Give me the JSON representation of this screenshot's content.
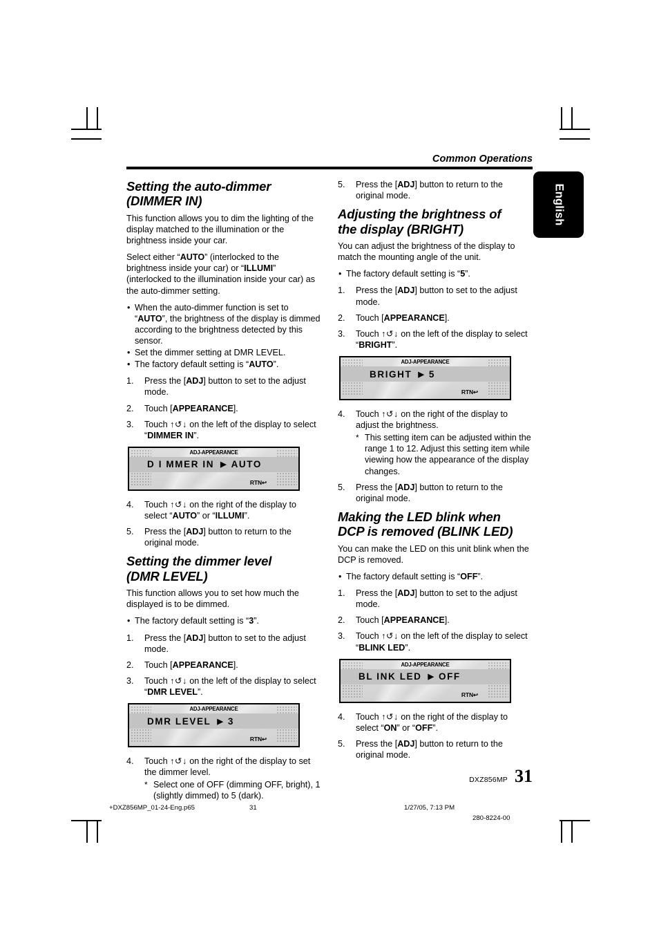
{
  "running_head": "Common Operations",
  "language_tab": "English",
  "left_column": {
    "section1": {
      "heading_line1": "Setting the auto-dimmer",
      "heading_line2": "(DIMMER IN)",
      "intro": "This function allows you to dim the lighting of the display matched to the illumination or the brightness inside your car.",
      "para2_a": "Select either “",
      "para2_b": "AUTO",
      "para2_c": "” (interlocked to the brightness inside your car) or “",
      "para2_d": "ILLUMI",
      "para2_e": "” (interlocked to the illumination inside your car) as the auto-dimmer setting.",
      "bullet1_a": "When the auto-dimmer function is set to “",
      "bullet1_b": "AUTO",
      "bullet1_c": "”, the brightness of the display is dimmed according to the brightness detected by this sensor.",
      "bullet2": "Set the dimmer setting at DMR LEVEL.",
      "bullet3_a": "The factory default setting is “",
      "bullet3_b": "AUTO",
      "bullet3_c": "”.",
      "step1_num": "1.",
      "step1_a": "Press the [",
      "step1_b": "ADJ",
      "step1_c": "] button to set to the adjust mode.",
      "step2_num": "2.",
      "step2_a": "Touch [",
      "step2_b": "APPEARANCE",
      "step2_c": "].",
      "step3_num": "3.",
      "step3_a": "Touch ",
      "step3_b": " on the left of the display to select “",
      "step3_c": "DIMMER IN",
      "step3_d": "”.",
      "lcd": {
        "title": "ADJ-APPEARANCE",
        "label": "D I MMER   IN",
        "arrow": "▶",
        "value": "AUTO",
        "rtn": "RTN"
      },
      "step4_num": "4.",
      "step4_a": "Touch ",
      "step4_b": " on the right of the display to select “",
      "step4_c": "AUTO",
      "step4_d": "” or “",
      "step4_e": "ILLUMI",
      "step4_f": "”.",
      "step5_num": "5.",
      "step5_a": "Press the [",
      "step5_b": "ADJ",
      "step5_c": "] button to return to the original mode."
    },
    "section2": {
      "heading_line1": "Setting the dimmer level",
      "heading_line2": "(DMR LEVEL)",
      "intro": "This function allows you to set how much the displayed is to be dimmed.",
      "bullet1_a": "The factory default setting is “",
      "bullet1_b": "3",
      "bullet1_c": "”.",
      "step1_num": "1.",
      "step1_a": "Press the [",
      "step1_b": "ADJ",
      "step1_c": "] button to set to the adjust mode.",
      "step2_num": "2.",
      "step2_a": "Touch [",
      "step2_b": "APPEARANCE",
      "step2_c": "].",
      "step3_num": "3.",
      "step3_a": "Touch ",
      "step3_b": " on the left of the display to select “",
      "step3_c": "DMR LEVEL",
      "step3_d": "”.",
      "lcd": {
        "title": "ADJ-APPEARANCE",
        "label": "DMR  LEVEL",
        "arrow": "▶",
        "value": "3",
        "rtn": "RTN"
      },
      "step4_num": "4.",
      "step4_a": "Touch ",
      "step4_b": " on the right of the display to set the dimmer level.",
      "step4_note": "Select one of OFF (dimming OFF, bright), 1 (slightly dimmed) to 5 (dark)."
    }
  },
  "right_column": {
    "top_step": {
      "num": "5.",
      "a": "Press the [",
      "b": "ADJ",
      "c": "] button to return to the original mode."
    },
    "section3": {
      "heading_line1": "Adjusting the brightness of",
      "heading_line2": "the display (BRIGHT)",
      "intro": "You can adjust the brightness of the display to match the mounting angle of the unit.",
      "bullet1_a": "The factory default setting is “",
      "bullet1_b": "5",
      "bullet1_c": "”.",
      "step1_num": "1.",
      "step1_a": "Press the [",
      "step1_b": "ADJ",
      "step1_c": "] button to set to the adjust mode.",
      "step2_num": "2.",
      "step2_a": "Touch [",
      "step2_b": "APPEARANCE",
      "step2_c": "].",
      "step3_num": "3.",
      "step3_a": "Touch ",
      "step3_b": " on the left of the display to select “",
      "step3_c": "BRIGHT",
      "step3_d": "”.",
      "lcd": {
        "title": "ADJ-APPEARANCE",
        "label": "BRIGHT",
        "arrow": "▶",
        "value": "5",
        "rtn": "RTN"
      },
      "step4_num": "4.",
      "step4_a": "Touch ",
      "step4_b": " on the right of the display to adjust the brightness.",
      "step4_note": "This setting item can be adjusted within the range 1 to 12. Adjust this setting item while viewing how the appearance of the display changes.",
      "step5_num": "5.",
      "step5_a": "Press the [",
      "step5_b": "ADJ",
      "step5_c": "] button to return to the original mode."
    },
    "section4": {
      "heading_line1": "Making the LED blink when",
      "heading_line2": "DCP is removed (BLINK LED)",
      "intro": "You can make the LED on this unit blink when the DCP is removed.",
      "bullet1_a": "The factory default setting is “",
      "bullet1_b": "OFF",
      "bullet1_c": "”.",
      "step1_num": "1.",
      "step1_a": "Press the [",
      "step1_b": "ADJ",
      "step1_c": "] button to set to the adjust mode.",
      "step2_num": "2.",
      "step2_a": "Touch [",
      "step2_b": "APPEARANCE",
      "step2_c": "].",
      "step3_num": "3.",
      "step3_a": "Touch ",
      "step3_b": " on the left of the display to select “",
      "step3_c": "BLINK LED",
      "step3_d": "”.",
      "lcd": {
        "title": "ADJ-APPEARANCE",
        "label": "BL INK  LED",
        "arrow": "▶",
        "value": "OFF",
        "rtn": "RTN"
      },
      "step4_num": "4.",
      "step4_a": "Touch ",
      "step4_b": " on the right of the display to select “",
      "step4_c": "ON",
      "step4_d": "” or “",
      "step4_e": "OFF",
      "step4_f": "”.",
      "step5_num": "5.",
      "step5_a": "Press the [",
      "step5_b": "ADJ",
      "step5_c": "] button to return to the original mode."
    }
  },
  "footer": {
    "model": "DXZ856MP",
    "page_number": "31"
  },
  "print_footer": {
    "filename": "+DXZ856MP_01-24-Eng.p65",
    "page": "31",
    "datetime": "1/27/05, 7:13 PM",
    "doc_code": "280-8224-00"
  },
  "icons": {
    "touch_up": "↑",
    "touch_rotate": "↺",
    "touch_down": "↓"
  }
}
